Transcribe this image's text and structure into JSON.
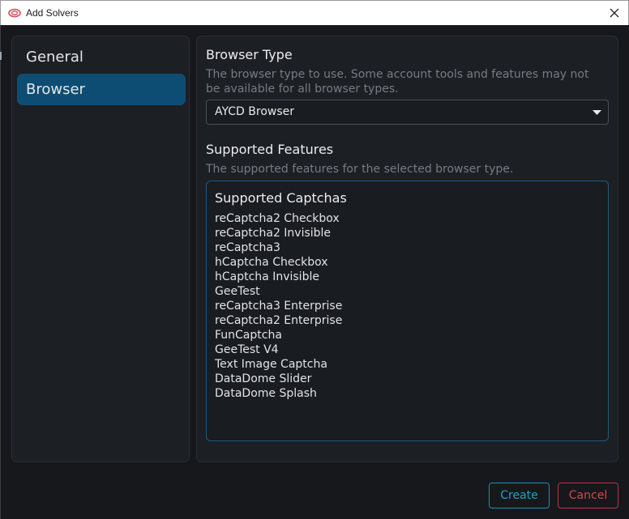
{
  "window": {
    "title": "Add Solvers",
    "app_icon": "aycd-logo-icon",
    "close_icon": "close-icon"
  },
  "sidebar": {
    "items": [
      {
        "label": "General",
        "active": false
      },
      {
        "label": "Browser",
        "active": true
      }
    ]
  },
  "browser_type": {
    "title": "Browser Type",
    "description": "The browser type to use. Some account tools and features may not be available for all browser types.",
    "selected": "AYCD Browser",
    "caret_icon": "caret-down-icon"
  },
  "supported_features": {
    "title": "Supported Features",
    "description": "The supported features for the selected browser type.",
    "box_heading": "Supported Captchas",
    "captchas": [
      "reCaptcha2 Checkbox",
      "reCaptcha2 Invisible",
      "reCaptcha3",
      "hCaptcha Checkbox",
      "hCaptcha Invisible",
      "GeeTest",
      "reCaptcha3 Enterprise",
      "reCaptcha2 Enterprise",
      "FunCaptcha",
      "GeeTest V4",
      "Text Image Captcha",
      "DataDome Slider",
      "DataDome Splash"
    ]
  },
  "actions": {
    "create_label": "Create",
    "cancel_label": "Cancel"
  },
  "colors": {
    "accent": "#0e4d73",
    "create": "#1fa3c6",
    "cancel": "#d8434f",
    "background": "#16181c"
  }
}
